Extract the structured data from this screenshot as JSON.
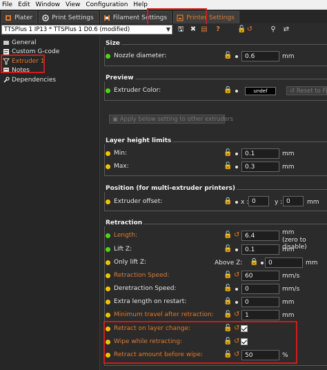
{
  "menubar": {
    "items": [
      "File",
      "Edit",
      "Window",
      "View",
      "Configuration",
      "Help"
    ]
  },
  "tabs": [
    {
      "label": "Plater",
      "icon": "plater-icon",
      "active": false
    },
    {
      "label": "Print Settings",
      "icon": "gear-icon",
      "active": false
    },
    {
      "label": "Filament Settings",
      "icon": "spool-icon",
      "active": false
    },
    {
      "label": "Printer Settings",
      "icon": "printer-icon",
      "active": true
    }
  ],
  "toolbar": {
    "preset_value": "TTSPlus 1 IP13 * TTSPlus 1 D0.6 (modified)"
  },
  "sidebar": {
    "items": [
      {
        "label": "General",
        "icon": "printer-icon",
        "selected": false
      },
      {
        "label": "Custom G-code",
        "icon": "code-icon",
        "selected": false
      },
      {
        "label": "Extruder 1",
        "icon": "funnel-icon",
        "selected": true
      },
      {
        "label": "Notes",
        "icon": "notes-icon",
        "selected": false
      },
      {
        "label": "Dependencies",
        "icon": "wrench-icon",
        "selected": false
      }
    ]
  },
  "size": {
    "title": "Size",
    "nozzle_label": "Nozzle diameter:",
    "nozzle_value": "0.6",
    "nozzle_unit": "mm"
  },
  "preview": {
    "title": "Preview",
    "color_label": "Extruder Color:",
    "color_value": "undef",
    "reset_label": "Reset to Filament Color",
    "apply_label": "Apply below setting to other extruders"
  },
  "layer_height": {
    "title": "Layer height limits",
    "min_label": "Min:",
    "min_value": "0.1",
    "max_label": "Max:",
    "max_value": "0.3",
    "unit": "mm"
  },
  "position": {
    "title": "Position (for multi-extruder printers)",
    "offset_label": "Extruder offset:",
    "x_label": "x :",
    "x_value": "0",
    "y_label": "y :",
    "y_value": "0",
    "unit": "mm"
  },
  "retraction": {
    "title": "Retraction",
    "length_label": "Length:",
    "length_value": "6.4",
    "length_unit_1": "mm",
    "length_unit_2": "(zero to disable)",
    "lift_label": "Lift Z:",
    "lift_value": "0.1",
    "lift_unit": "mm",
    "only_lift_label": "Only lift Z:",
    "above_label": "Above Z:",
    "above_value": "0",
    "above_unit": "mm",
    "speed_label": "Retraction Speed:",
    "speed_value": "60",
    "speed_unit": "mm/s",
    "deretract_label": "Deretraction Speed:",
    "deretract_value": "0",
    "deretract_unit": "mm/s",
    "extra_label": "Extra length on restart:",
    "extra_value": "0",
    "extra_unit": "mm",
    "min_travel_label": "Minimum travel after retraction:",
    "min_travel_value": "1",
    "min_travel_unit": "mm",
    "layer_change_label": "Retract on layer change:",
    "layer_change_checked": true,
    "wipe_label": "Wipe while retracting:",
    "wipe_checked": true,
    "before_wipe_label": "Retract amount before wipe:",
    "before_wipe_value": "50",
    "before_wipe_unit": "%"
  },
  "colors": {
    "accent": "#e07a2e",
    "highlight": "#d01c1c",
    "green": "#4fd51b",
    "yellow": "#f2c500"
  }
}
